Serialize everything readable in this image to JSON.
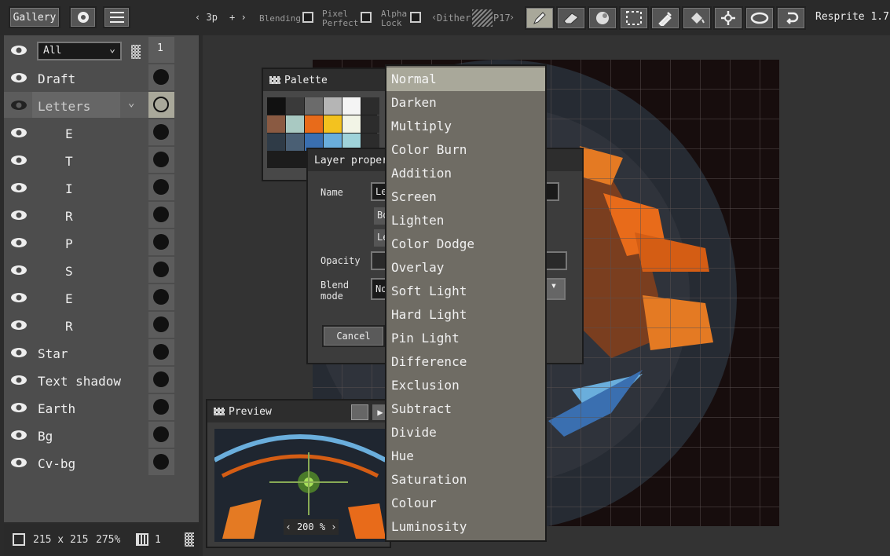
{
  "app": {
    "title": "Resprite 1.7"
  },
  "topbar": {
    "gallery_label": "Gallery",
    "brush_size": "3p",
    "blending_label": "Blending",
    "pixel_perfect_label": [
      "Pixel",
      "Perfect"
    ],
    "alpha_lock_label": [
      "Alpha",
      "Lock"
    ],
    "dither_label": "Dither",
    "dither_pattern": "P17",
    "tools": [
      "pencil-icon",
      "eraser-icon",
      "fill-icon",
      "selection-icon",
      "eyedropper-icon",
      "bucket-icon",
      "move-icon",
      "ellipse-icon",
      "rotate-icon"
    ],
    "active_tool": "pencil-icon"
  },
  "layers": {
    "filter_value": "All",
    "frame_number": "1",
    "items": [
      {
        "name": "Draft",
        "indent": false
      },
      {
        "name": "Letters",
        "indent": false,
        "group": true,
        "selected": true
      },
      {
        "name": "E",
        "indent": true
      },
      {
        "name": "T",
        "indent": true
      },
      {
        "name": "I",
        "indent": true
      },
      {
        "name": "R",
        "indent": true
      },
      {
        "name": "P",
        "indent": true
      },
      {
        "name": "S",
        "indent": true
      },
      {
        "name": "E",
        "indent": true
      },
      {
        "name": "R",
        "indent": true
      },
      {
        "name": "Star",
        "indent": false
      },
      {
        "name": "Text shadow",
        "indent": false
      },
      {
        "name": "Earth",
        "indent": false
      },
      {
        "name": "Bg",
        "indent": false
      },
      {
        "name": "Cv-bg",
        "indent": false
      }
    ]
  },
  "status": {
    "canvas_size": "215 x 215",
    "zoom": "275%",
    "frames": "1"
  },
  "palette": {
    "title": "Palette",
    "colors": [
      "#111111",
      "#3a3a3a",
      "#6b6b6b",
      "#b5b5b5",
      "#f4f4f4",
      "#2c2c2c",
      "#8a5a42",
      "#a9c9c2",
      "#e86b1a",
      "#f3c21f",
      "#f2f4e6",
      "#2c2c2c",
      "#2f3b47",
      "#4a5f74",
      "#3a6fb0",
      "#6aaedc",
      "#9fd3da",
      "#2c2c2c"
    ]
  },
  "layer_props": {
    "title": "Layer propert",
    "name_label": "Name",
    "name_value": "Le",
    "opacity_label": "Opacity",
    "blend_label": [
      "Blend",
      "mode"
    ],
    "blend_value": "No",
    "row2_value": "Bo",
    "row3_value": "Le",
    "cancel_label": "Cancel"
  },
  "preview": {
    "title": "Preview",
    "zoom": "200 %"
  },
  "blend_modes": [
    "Normal",
    "Darken",
    "Multiply",
    "Color Burn",
    "Addition",
    "Screen",
    "Lighten",
    "Color Dodge",
    "Overlay",
    "Soft Light",
    "Hard Light",
    "Pin Light",
    "Difference",
    "Exclusion",
    "Subtract",
    "Divide",
    "Hue",
    "Saturation",
    "Colour",
    "Luminosity"
  ],
  "selected_blend": "Normal"
}
